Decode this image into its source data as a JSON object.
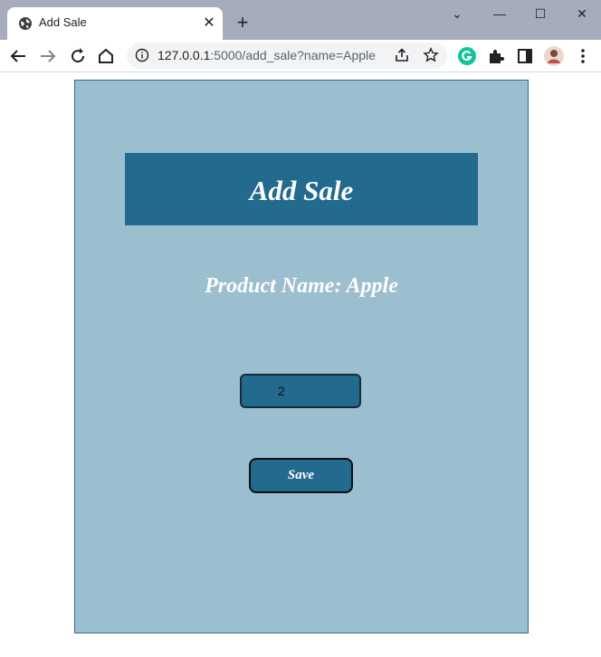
{
  "browser": {
    "tab_title": "Add Sale",
    "tab_close": "✕",
    "new_tab": "+",
    "window_controls": {
      "minimize": "—",
      "maximize": "☐",
      "close": "✕",
      "tab_search": "⌄"
    },
    "url_host": "127.0.0.1",
    "url_rest": ":5000/add_sale?name=Apple",
    "icons": [
      "globe-icon",
      "back-icon",
      "forward-icon",
      "reload-icon",
      "home-icon",
      "info-icon",
      "share-icon",
      "star-icon",
      "grammarly-icon",
      "extensions-icon",
      "side-panel-icon",
      "profile-avatar",
      "menu-icon"
    ],
    "colors": {
      "tab_strip": "#a7acbd",
      "omnibox": "#f1f3f4",
      "grammarly": "#15c39a"
    }
  },
  "page": {
    "heading": "Add Sale",
    "product_label": "Product Name: Apple",
    "quantity_value": "2",
    "save_label": "Save",
    "colors": {
      "card": "#9bbfcf",
      "accent": "#226a8e",
      "text": "#ffffff"
    }
  }
}
